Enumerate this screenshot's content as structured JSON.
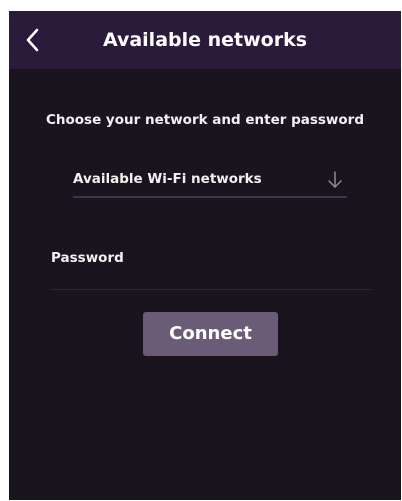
{
  "header": {
    "title": "Available networks",
    "back_icon": "chevron-left-icon"
  },
  "main": {
    "instructions": "Choose your network and enter password",
    "network_select": {
      "label": "Available Wi-Fi networks",
      "icon": "arrow-down-icon"
    },
    "password": {
      "label": "Password",
      "value": ""
    },
    "connect_label": "Connect"
  },
  "colors": {
    "header_bg": "#2a1b3a",
    "page_bg": "#1a141f",
    "button_bg": "#6a5c77",
    "text": "#f2f2f2"
  }
}
